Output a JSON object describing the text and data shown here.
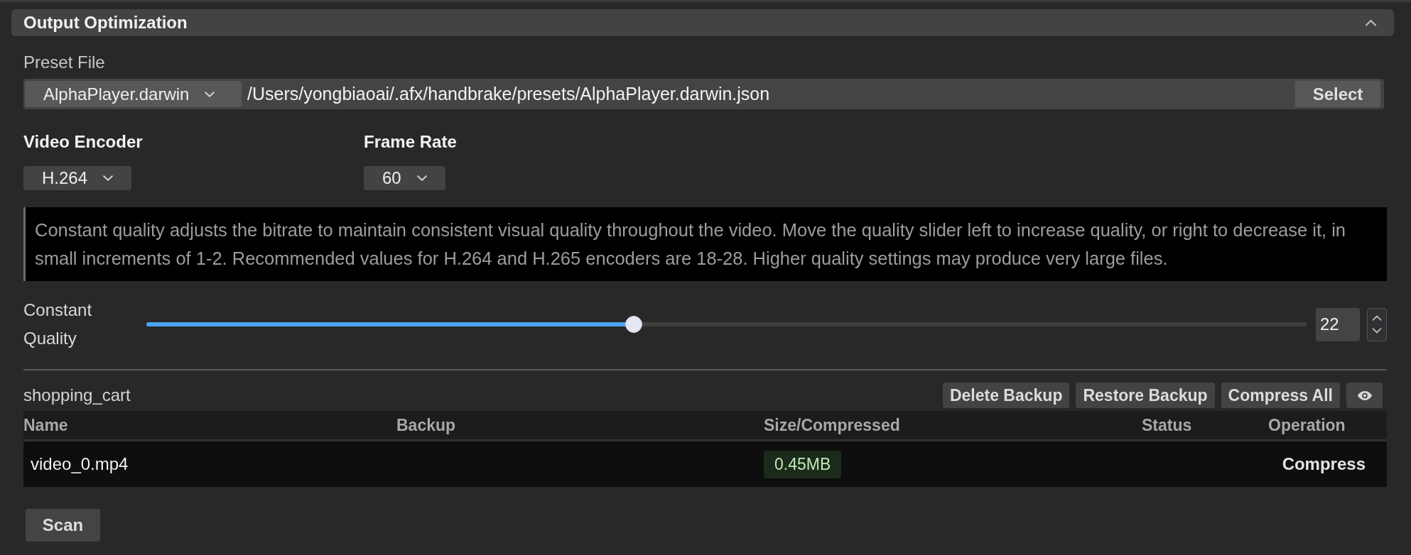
{
  "section": {
    "title": "Output Optimization",
    "expanded": true
  },
  "preset_file": {
    "label": "Preset File",
    "preset": "AlphaPlayer.darwin",
    "path": "/Users/yongbiaoai/.afx/handbrake/presets/AlphaPlayer.darwin.json",
    "button": "Select"
  },
  "video_encoder": {
    "label": "Video Encoder",
    "value": "H.264"
  },
  "frame_rate": {
    "label": "Frame Rate",
    "value": "60"
  },
  "description": "Constant quality adjusts the bitrate to maintain consistent visual quality throughout the video. Move the quality slider left to increase quality, or right to decrease it, in small increments of 1-2. Recommended values for H.264 and H.265 encoders are 18-28. Higher quality settings may produce very large files.",
  "constant_quality": {
    "label": "Constant Quality",
    "level": 0.42,
    "value": "22"
  },
  "file_list": {
    "title": "shopping_cart",
    "buttons": [
      "Delete Backup",
      "Restore Backup",
      "Compress All"
    ]
  },
  "table": {
    "columns": [
      "Name",
      "Backup",
      "Size/Compressed",
      "Status",
      "Operation"
    ],
    "rows": [
      {
        "name": "video_0.mp4",
        "size": "0.45MB",
        "operation": "Compress"
      }
    ]
  },
  "scan_button": "Scan"
}
